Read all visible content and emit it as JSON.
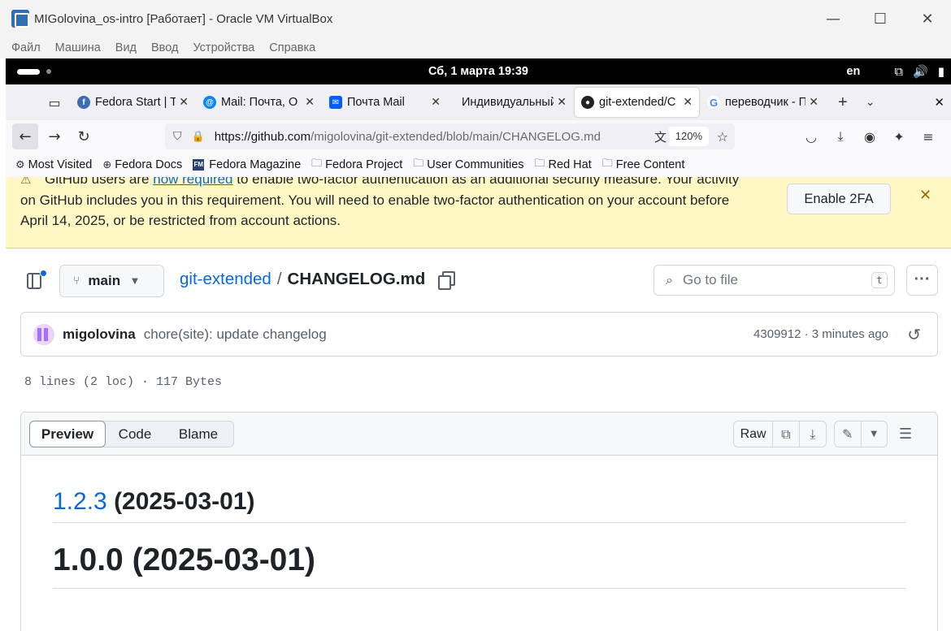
{
  "vbox": {
    "title": "MIGolovina_os-intro [Работает] - Oracle VM VirtualBox",
    "menu": [
      "Файл",
      "Машина",
      "Вид",
      "Ввод",
      "Устройства",
      "Справка"
    ],
    "controls": {
      "minimize": "—",
      "maximize": "☐",
      "close": "✕"
    }
  },
  "gnome": {
    "clock": "Сб, 1 марта  19:39",
    "lang": "en"
  },
  "tabs": [
    {
      "label": "Fedora Start | T",
      "favicon_color": "#3c6eb4",
      "active": false
    },
    {
      "label": "Mail: Почта, О",
      "favicon_color": "#0a84ff",
      "active": false
    },
    {
      "label": "Почта Mail",
      "favicon_color": "#005ff9",
      "active": false
    },
    {
      "label": "Индивидуальный",
      "favicon_color": "",
      "active": false
    },
    {
      "label": "git-extended/C",
      "favicon_color": "#1f2328",
      "active": true
    },
    {
      "label": "переводчик - П",
      "favicon_color": "#4285f4",
      "active": false
    }
  ],
  "nav": {
    "url_host": "https://github.com",
    "url_path": "/migolovina/git-extended/blob/main/CHANGELOG.md",
    "zoom": "120%"
  },
  "bookmarks": [
    "Most Visited",
    "Fedora Docs",
    "Fedora Magazine",
    "Fedora Project",
    "User Communities",
    "Red Hat",
    "Free Content"
  ],
  "banner": {
    "line1_prefix": "GitHub users are ",
    "line1_link": "now required",
    "line1_suffix": " to enable two-factor authentication as an additional security measure. Your activity on GitHub includes you in this requirement. You will need to enable two-factor authentication on your account before April 14, 2025, or be restricted from account actions.",
    "button": "Enable 2FA"
  },
  "file": {
    "branch": "main",
    "repo": "git-extended",
    "separator": "/",
    "filename": "CHANGELOG.md",
    "goto_placeholder": "Go to file",
    "goto_kbd": "t",
    "commit_author": "migolovina",
    "commit_message": "chore(site): update changelog",
    "commit_meta": "4309912 · 3 minutes ago",
    "info": "8 lines (2 loc) · 117 Bytes",
    "views": [
      "Preview",
      "Code",
      "Blame"
    ],
    "raw": "Raw"
  },
  "markdown": {
    "h2_link": "1.2.3",
    "h2_rest": " (2025-03-01)",
    "h1": "1.0.0 (2025-03-01)"
  }
}
